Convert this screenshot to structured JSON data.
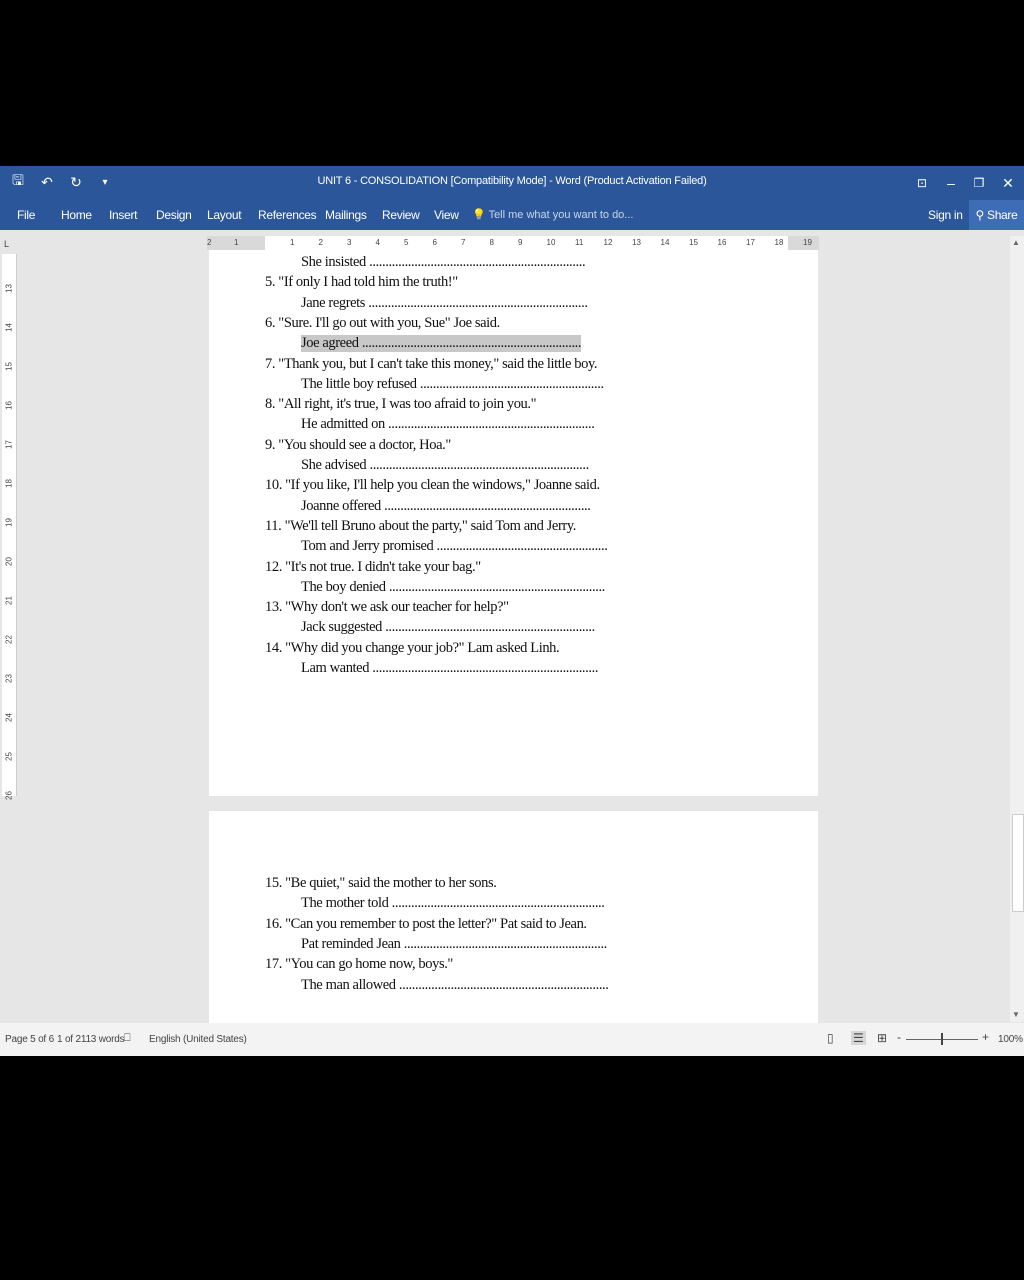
{
  "titlebar": {
    "title": "UNIT 6 - CONSOLIDATION [Compatibility Mode] - Word (Product Activation Failed)",
    "quick_access": [
      {
        "icon": "save-icon",
        "glyph": "🖫"
      },
      {
        "icon": "undo-icon",
        "glyph": "↶"
      },
      {
        "icon": "redo-icon",
        "glyph": "↻"
      },
      {
        "icon": "customize-qat-icon",
        "glyph": "▾"
      }
    ],
    "window_buttons": [
      {
        "icon": "ribbon-display-icon",
        "glyph": "⊡"
      },
      {
        "icon": "minimize-icon",
        "glyph": "–"
      },
      {
        "icon": "restore-icon",
        "glyph": "❐"
      },
      {
        "icon": "close-icon",
        "glyph": "✕"
      }
    ]
  },
  "ribbon": {
    "tabs": [
      "File",
      "Home",
      "Insert",
      "Design",
      "Layout",
      "References",
      "Mailings",
      "Review",
      "View"
    ],
    "tell_me": "Tell me what you want to do...",
    "sign_in": "Sign in",
    "share": "Share"
  },
  "ruler": {
    "corner": "L",
    "h_numbers": [
      "2",
      "1",
      "1",
      "2",
      "3",
      "4",
      "5",
      "6",
      "7",
      "8",
      "9",
      "10",
      "11",
      "12",
      "13",
      "14",
      "15",
      "16",
      "17",
      "18",
      "19"
    ],
    "v_numbers": [
      "13",
      "14",
      "15",
      "16",
      "17",
      "18",
      "19",
      "20",
      "21",
      "22",
      "23",
      "24",
      "25",
      "26"
    ]
  },
  "page1": {
    "lines": [
      {
        "kind": "a",
        "text": "She insisted ..................................................................."
      },
      {
        "kind": "q",
        "text": "5. \"If only I had told him the truth!\""
      },
      {
        "kind": "a",
        "text": "Jane regrets ...................................................................."
      },
      {
        "kind": "q",
        "text": "6. \"Sure. I'll go out with you, Sue\" Joe said."
      },
      {
        "kind": "a",
        "text": "Joe agreed ....................................................................",
        "highlight": true
      },
      {
        "kind": "q",
        "text": "7. \"Thank you, but I can't take this money,\" said the little boy."
      },
      {
        "kind": "a",
        "text": "The little boy refused ........................................................."
      },
      {
        "kind": "q",
        "text": "8. \"All right, it's true, I was too afraid to join you.\""
      },
      {
        "kind": "a",
        "text": "He admitted on ................................................................"
      },
      {
        "kind": "q",
        "text": "9. \"You should see a doctor, Hoa.\""
      },
      {
        "kind": "a",
        "text": "She advised ...................................................................."
      },
      {
        "kind": "q",
        "text": "10. \"If you like, I'll help you clean the windows,\" Joanne said."
      },
      {
        "kind": "a",
        "text": "Joanne offered ................................................................"
      },
      {
        "kind": "q",
        "text": "11. \"We'll tell Bruno about the party,\" said Tom and Jerry."
      },
      {
        "kind": "a",
        "text": "Tom and Jerry promised ....................................................."
      },
      {
        "kind": "q",
        "text": "12. \"It's not true. I didn't take your bag.\""
      },
      {
        "kind": "a",
        "text": "The boy denied ..................................................................."
      },
      {
        "kind": "q",
        "text": "13. \"Why don't we ask our teacher for help?\""
      },
      {
        "kind": "a",
        "text": "Jack suggested ................................................................."
      },
      {
        "kind": "q",
        "text": "14. \"Why did you change your job?\" Lam asked Linh."
      },
      {
        "kind": "a",
        "text": "Lam wanted ......................................................................"
      }
    ]
  },
  "page2": {
    "lines": [
      {
        "kind": "q",
        "text": "15. \"Be quiet,\" said the mother to her sons."
      },
      {
        "kind": "a",
        "text": "The mother told .................................................................."
      },
      {
        "kind": "q",
        "text": "16. \"Can you remember to post the letter?\" Pat said to Jean."
      },
      {
        "kind": "a",
        "text": "Pat reminded Jean ..............................................................."
      },
      {
        "kind": "q",
        "text": "17. \"You can go home now, boys.\""
      },
      {
        "kind": "a",
        "text": "The man allowed ................................................................."
      }
    ]
  },
  "statusbar": {
    "page": "Page 5 of 6",
    "words": "1 of 2113 words",
    "proofing_icon": "proofing-icon",
    "language": "English (United States)",
    "zoom_minus": "-",
    "zoom_plus": "+",
    "zoom_value": "100%",
    "zoom_level": 1.0
  }
}
